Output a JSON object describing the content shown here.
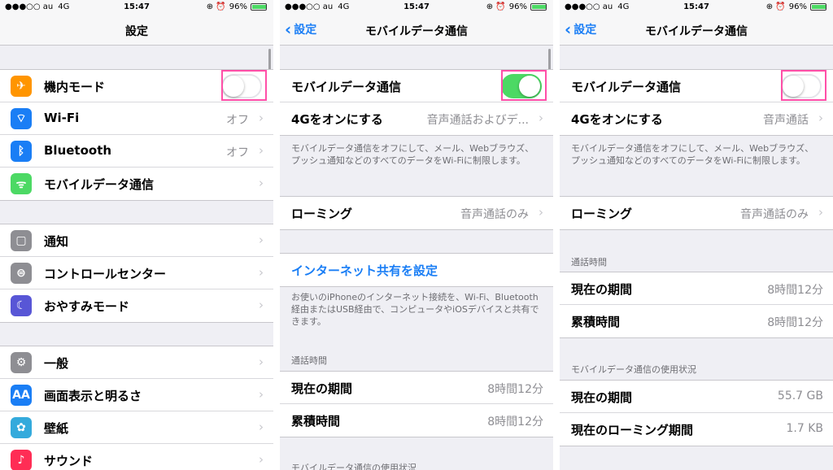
{
  "status": {
    "carrier": "●●●○○ au",
    "network": "4G",
    "time": "15:47",
    "icons": "⊕ ⏰",
    "battery": "96%",
    "battery_level": 0.96
  },
  "screen1": {
    "title": "設定",
    "groups": [
      [
        {
          "icon": "✈",
          "icon_name": "airplane-icon",
          "color": "#ff9500",
          "label": "機内モード",
          "toggle": "off"
        },
        {
          "icon": "⌔",
          "icon_name": "wifi-icon",
          "color": "#1a7ef5",
          "label": "Wi-Fi",
          "value": "オフ"
        },
        {
          "icon": "ᛒ",
          "icon_name": "bluetooth-icon",
          "color": "#1a7ef5",
          "label": "Bluetooth",
          "value": "オフ"
        },
        {
          "icon": "ᯤ",
          "icon_name": "antenna-icon",
          "color": "#4cd964",
          "label": "モバイルデータ通信",
          "value": ""
        }
      ],
      [
        {
          "icon": "▢",
          "icon_name": "notifications-icon",
          "color": "#8e8e93",
          "label": "通知",
          "value": ""
        },
        {
          "icon": "⊜",
          "icon_name": "control-center-icon",
          "color": "#8e8e93",
          "label": "コントロールセンター",
          "value": ""
        },
        {
          "icon": "☾",
          "icon_name": "moon-icon",
          "color": "#5856d6",
          "label": "おやすみモード",
          "value": ""
        }
      ],
      [
        {
          "icon": "⚙",
          "icon_name": "gear-icon",
          "color": "#8e8e93",
          "label": "一般",
          "value": ""
        },
        {
          "icon": "AA",
          "icon_name": "display-icon",
          "color": "#1a7ef5",
          "label": "画面表示と明るさ",
          "value": ""
        },
        {
          "icon": "✿",
          "icon_name": "wallpaper-icon",
          "color": "#34aadc",
          "label": "壁紙",
          "value": ""
        },
        {
          "icon": "♪",
          "icon_name": "sound-icon",
          "color": "#ff2d55",
          "label": "サウンド",
          "value": ""
        }
      ]
    ]
  },
  "screen2": {
    "back": "設定",
    "title": "モバイルデータ通信",
    "mobile_data": {
      "label": "モバイルデータ通信",
      "toggle": "on"
    },
    "lte": {
      "label": "4Gをオンにする",
      "value": "音声通話およびデ..."
    },
    "note1": "モバイルデータ通信をオフにして、メール、Webブラウズ、プッシュ通知などのすべてのデータをWi-Fiに制限します。",
    "roaming": {
      "label": "ローミング",
      "value": "音声通話のみ"
    },
    "hotspot_link": "インターネット共有を設定",
    "note2": "お使いのiPhoneのインターネット接続を、Wi-Fi、Bluetooth経由またはUSB経由で、コンピュータやiOSデバイスと共有できます。",
    "call_time_header": "通話時間",
    "current_period": {
      "label": "現在の期間",
      "value": "8時間12分"
    },
    "lifetime": {
      "label": "累積時間",
      "value": "8時間12分"
    },
    "usage_header": "モバイルデータ通信の使用状況"
  },
  "screen3": {
    "back": "設定",
    "title": "モバイルデータ通信",
    "mobile_data": {
      "label": "モバイルデータ通信",
      "toggle": "off"
    },
    "lte": {
      "label": "4Gをオンにする",
      "value": "音声通話"
    },
    "note1": "モバイルデータ通信をオフにして、メール、Webブラウズ、プッシュ通知などのすべてのデータをWi-Fiに制限します。",
    "roaming": {
      "label": "ローミング",
      "value": "音声通話のみ"
    },
    "call_time_header": "通話時間",
    "current_period": {
      "label": "現在の期間",
      "value": "8時間12分"
    },
    "lifetime": {
      "label": "累積時間",
      "value": "8時間12分"
    },
    "usage_header": "モバイルデータ通信の使用状況",
    "usage_current": {
      "label": "現在の期間",
      "value": "55.7 GB"
    },
    "usage_roaming": {
      "label": "現在のローミング期間",
      "value": "1.7 KB"
    }
  },
  "colors": {
    "accent": "#1a7ef5",
    "toggle_on": "#4cd964",
    "highlight": "#ff4fa8"
  }
}
